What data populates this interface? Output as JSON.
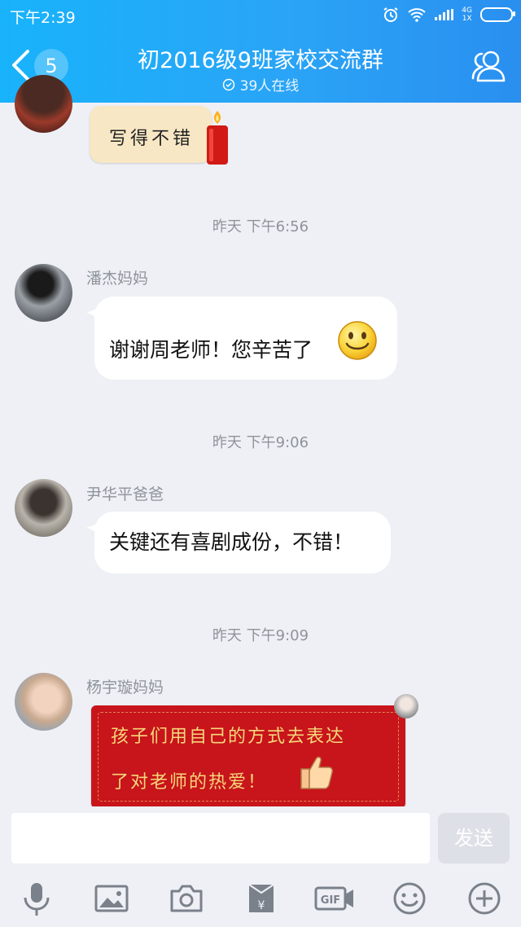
{
  "status_bar": {
    "time": "下午2:39",
    "network_top": "4G",
    "network_bottom": "1X"
  },
  "header": {
    "back_count": "5",
    "title": "初2016级9班家校交流群",
    "online": "39人在线"
  },
  "chat": {
    "messages": [
      {
        "type": "sticker",
        "text": "写得不错"
      },
      {
        "timestamp": "昨天 下午6:56",
        "sender": "潘杰妈妈",
        "text": "谢谢周老师！您辛苦了",
        "emoji": "smile-emoji"
      },
      {
        "timestamp": "昨天 下午9:06",
        "sender": "尹华平爸爸",
        "text": "关键还有喜剧成份，不错！"
      },
      {
        "timestamp": "昨天 下午9:09",
        "sender": "杨宇璇妈妈",
        "line1": "孩子们用自己的方式去表达",
        "line2": "了对老师的热爱！"
      }
    ]
  },
  "input": {
    "send_label": "发送"
  },
  "toolbar": {
    "icons": [
      "microphone-icon",
      "image-icon",
      "camera-icon",
      "red-packet-icon",
      "gif-icon",
      "emoji-icon",
      "plus-icon"
    ]
  },
  "colors": {
    "header_start": "#18b3fb",
    "header_end": "#2a8ff0",
    "background": "#eef0f6",
    "red_bubble": "#c8141b",
    "gold_text": "#f5d77a"
  }
}
